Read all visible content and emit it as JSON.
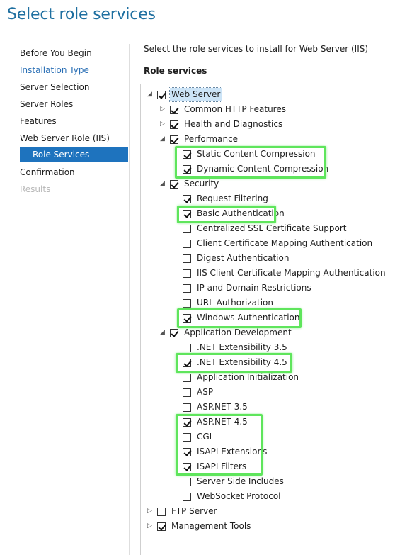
{
  "page_title": "Select role services",
  "nav": [
    {
      "label": "Before You Begin",
      "state": "normal"
    },
    {
      "label": "Installation Type",
      "state": "link"
    },
    {
      "label": "Server Selection",
      "state": "normal"
    },
    {
      "label": "Server Roles",
      "state": "normal"
    },
    {
      "label": "Features",
      "state": "normal"
    },
    {
      "label": "Web Server Role (IIS)",
      "state": "normal"
    },
    {
      "label": "Role Services",
      "state": "active"
    },
    {
      "label": "Confirmation",
      "state": "normal"
    },
    {
      "label": "Results",
      "state": "disabled"
    }
  ],
  "intro_text": "Select the role services to install for Web Server (IIS)",
  "role_services_label": "Role services",
  "tree": [
    {
      "label": "Web Server",
      "level": 0,
      "expander": "expanded",
      "checked": true,
      "selected": true
    },
    {
      "label": "Common HTTP Features",
      "level": 1,
      "expander": "collapsed",
      "checked": true
    },
    {
      "label": "Health and Diagnostics",
      "level": 1,
      "expander": "collapsed",
      "checked": true
    },
    {
      "label": "Performance",
      "level": 1,
      "expander": "expanded",
      "checked": true
    },
    {
      "label": "Static Content Compression",
      "level": 2,
      "expander": "none",
      "checked": true
    },
    {
      "label": "Dynamic Content Compression",
      "level": 2,
      "expander": "none",
      "checked": true
    },
    {
      "label": "Security",
      "level": 1,
      "expander": "expanded",
      "checked": true
    },
    {
      "label": "Request Filtering",
      "level": 2,
      "expander": "none",
      "checked": true
    },
    {
      "label": "Basic Authentication",
      "level": 2,
      "expander": "none",
      "checked": true
    },
    {
      "label": "Centralized SSL Certificate Support",
      "level": 2,
      "expander": "none",
      "checked": false
    },
    {
      "label": "Client Certificate Mapping Authentication",
      "level": 2,
      "expander": "none",
      "checked": false
    },
    {
      "label": "Digest Authentication",
      "level": 2,
      "expander": "none",
      "checked": false
    },
    {
      "label": "IIS Client Certificate Mapping Authentication",
      "level": 2,
      "expander": "none",
      "checked": false
    },
    {
      "label": "IP and Domain Restrictions",
      "level": 2,
      "expander": "none",
      "checked": false
    },
    {
      "label": "URL Authorization",
      "level": 2,
      "expander": "none",
      "checked": false
    },
    {
      "label": "Windows Authentication",
      "level": 2,
      "expander": "none",
      "checked": true
    },
    {
      "label": "Application Development",
      "level": 1,
      "expander": "expanded",
      "checked": true
    },
    {
      "label": ".NET Extensibility 3.5",
      "level": 2,
      "expander": "none",
      "checked": false
    },
    {
      "label": ".NET Extensibility 4.5",
      "level": 2,
      "expander": "none",
      "checked": true
    },
    {
      "label": "Application Initialization",
      "level": 2,
      "expander": "none",
      "checked": false
    },
    {
      "label": "ASP",
      "level": 2,
      "expander": "none",
      "checked": false
    },
    {
      "label": "ASP.NET 3.5",
      "level": 2,
      "expander": "none",
      "checked": false
    },
    {
      "label": "ASP.NET 4.5",
      "level": 2,
      "expander": "none",
      "checked": true
    },
    {
      "label": "CGI",
      "level": 2,
      "expander": "none",
      "checked": false
    },
    {
      "label": "ISAPI Extensions",
      "level": 2,
      "expander": "none",
      "checked": true
    },
    {
      "label": "ISAPI Filters",
      "level": 2,
      "expander": "none",
      "checked": true
    },
    {
      "label": "Server Side Includes",
      "level": 2,
      "expander": "none",
      "checked": false
    },
    {
      "label": "WebSocket Protocol",
      "level": 2,
      "expander": "none",
      "checked": false
    },
    {
      "label": "FTP Server",
      "level": 0,
      "expander": "collapsed",
      "checked": false
    },
    {
      "label": "Management Tools",
      "level": 0,
      "expander": "collapsed",
      "checked": true
    }
  ],
  "highlight_color": "#5fe55c",
  "accent_color": "#1e73be"
}
